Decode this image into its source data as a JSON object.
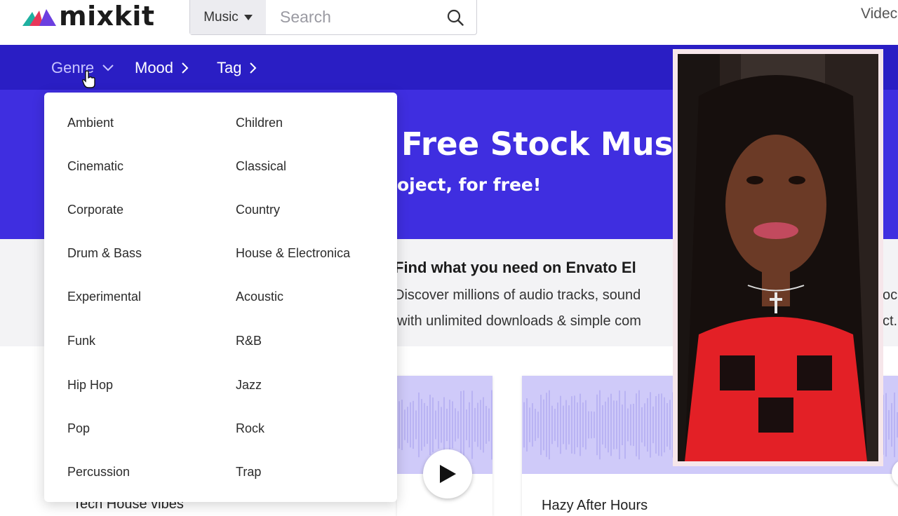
{
  "header": {
    "logo_text": "mixkit",
    "search_category": "Music",
    "search_placeholder": "Search",
    "top_right_link": "Videc"
  },
  "nav": {
    "genre": "Genre",
    "mood": "Mood",
    "tag": "Tag"
  },
  "hero": {
    "title": "Free Stock Musi",
    "subtitle": "oject, for free!"
  },
  "envato": {
    "title": "Find what you need on Envato El",
    "line1": "Discover millions of audio tracks, sound",
    "line2": "with unlimited downloads & simple com",
    "right1": "ock",
    "right2": "ct."
  },
  "genre_menu": {
    "left": [
      "Ambient",
      "Cinematic",
      "Corporate",
      "Drum & Bass",
      "Experimental",
      "Funk",
      "Hip Hop",
      "Pop",
      "Percussion"
    ],
    "right": [
      "Children",
      "Classical",
      "Country",
      "House & Electronica",
      "Acoustic",
      "R&B",
      "Jazz",
      "Rock",
      "Trap"
    ]
  },
  "cards": {
    "card1_title": "Tech House vibes",
    "card2_title": "Hazy After Hours"
  },
  "colors": {
    "navbar": "#2a1ec4",
    "hero": "#3f2ee0",
    "wave_bg": "#cfcaf9",
    "wave_bar": "#b9b3f3"
  }
}
